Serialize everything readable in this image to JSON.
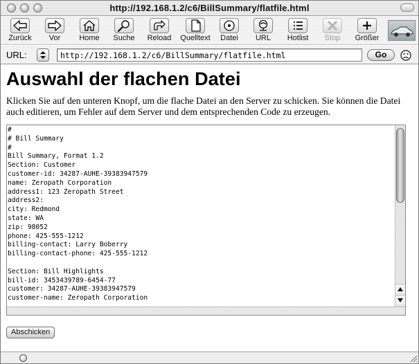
{
  "window": {
    "title": "http://192.168.1.2/c6/BillSummary/flatfile.html"
  },
  "toolbar": {
    "buttons": [
      {
        "label": "Zurück",
        "icon": "back-arrow-icon"
      },
      {
        "label": "Vor",
        "icon": "forward-arrow-icon"
      },
      {
        "label": "Home",
        "icon": "home-icon"
      },
      {
        "label": "Suche",
        "icon": "search-icon"
      },
      {
        "label": "Reload",
        "icon": "reload-icon"
      },
      {
        "label": "Quelltext",
        "icon": "source-icon"
      },
      {
        "label": "Datei",
        "icon": "file-icon"
      },
      {
        "label": "URL",
        "icon": "url-icon"
      },
      {
        "label": "Hotlist",
        "icon": "hotlist-icon"
      },
      {
        "label": "Stop",
        "icon": "stop-icon",
        "disabled": true
      },
      {
        "label": "Größer",
        "icon": "enlarge-icon"
      }
    ]
  },
  "urlbar": {
    "label": "URL:",
    "value": "http://192.168.1.2/c6/BillSummary/flatfile.html",
    "go_label": "Go"
  },
  "content": {
    "heading": "Auswahl der flachen Datei",
    "intro": "Klicken Sie auf den unteren Knopf, um die flache Datei an den Server zu schicken. Sie können die Datei auch editieren, um Fehler auf dem Server und dem entsprechenden Code zu erzeugen.",
    "textarea_lines": [
      "#",
      "# Bill Summary",
      "#",
      "Bill Summary, Format 1.2",
      "Section: Customer",
      "customer-id: 34287-AUHE-39383947579",
      "name: Zeropath Corporation",
      "address1: 123 Zeropath Street",
      "address2:",
      "city: Redmond",
      "state: WA",
      "zip: 98052",
      "phone: 425-555-1212",
      "billing-contact: Larry Boberry",
      "billing-contact-phone: 425-555-1212",
      "",
      "Section: Bill Highlights",
      "bill-id: 3453439789-6454-77",
      "customer: 34287-AUHE-39383947579",
      "customer-name: Zeropath Corporation"
    ],
    "submit_label": "Abschicken"
  }
}
